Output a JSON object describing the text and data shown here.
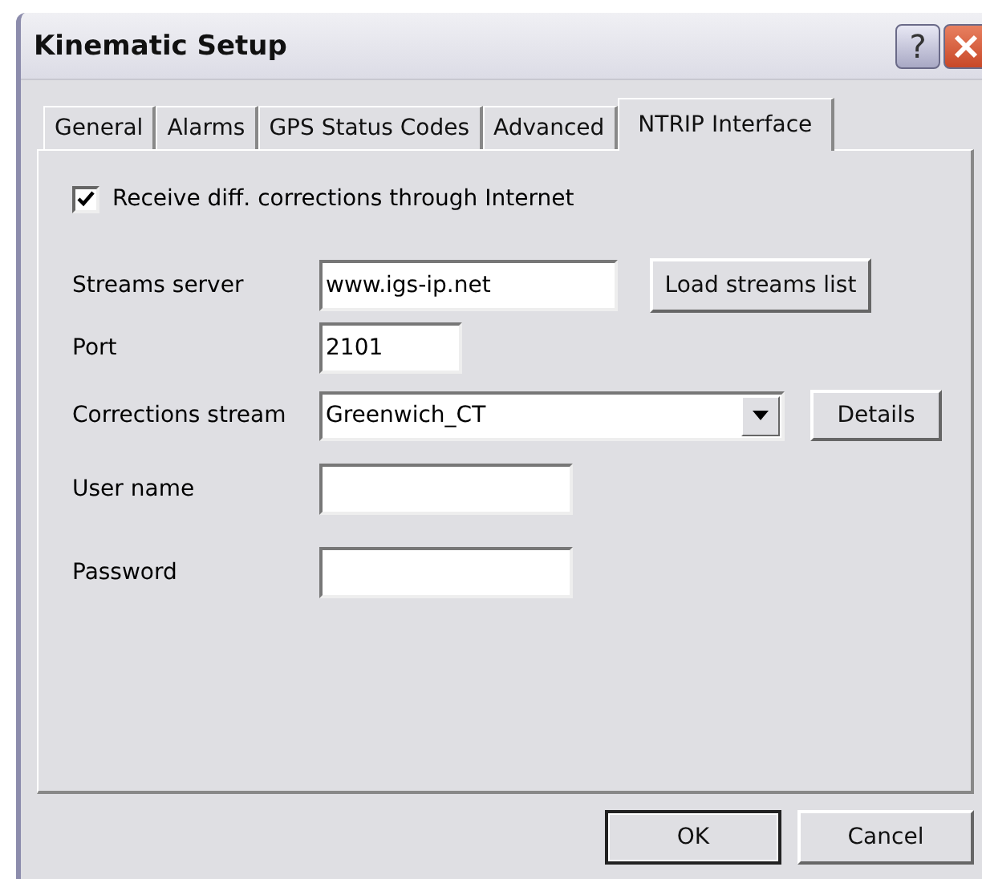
{
  "window": {
    "title": "Kinematic Setup"
  },
  "title_buttons": [
    {
      "kind": "help",
      "label": "?"
    },
    {
      "kind": "close"
    }
  ],
  "tabs": [
    {
      "label": "General",
      "selected": false
    },
    {
      "label": "Alarms",
      "selected": false
    },
    {
      "label": "GPS Status Codes",
      "selected": false
    },
    {
      "label": "Advanced",
      "selected": false
    },
    {
      "label": "NTRIP Interface",
      "selected": true
    }
  ],
  "receive_corrections": {
    "label": "Receive diff. corrections through Internet",
    "checked": true
  },
  "streams_server": {
    "label": "Streams server",
    "value": "www.igs-ip.net",
    "button": "Load streams list"
  },
  "port": {
    "label": "Port",
    "value": "2101"
  },
  "corrections_stream": {
    "label": "Corrections stream",
    "value": "Greenwich_CT",
    "button": "Details"
  },
  "user_name": {
    "label": "User name"
  },
  "password": {
    "label": "Password"
  },
  "buttons": [
    "OK",
    "Cancel"
  ]
}
